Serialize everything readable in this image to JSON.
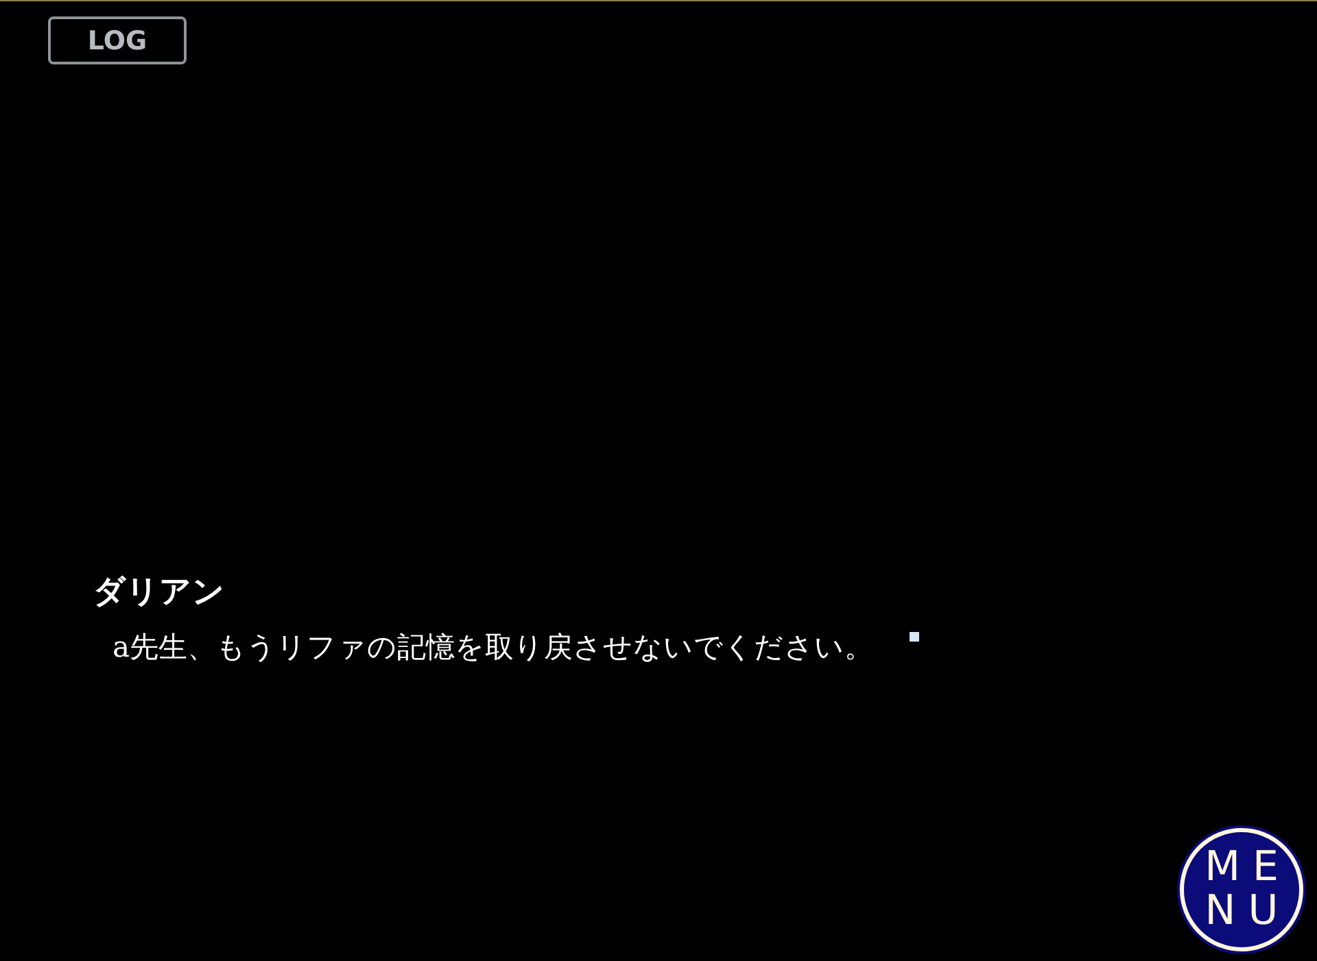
{
  "log_button": {
    "label": "LOG"
  },
  "dialogue": {
    "speaker": "ダリアン",
    "text": "a先生、もうリファの記憶を取り戻させないでください。"
  },
  "menu_button": {
    "label": "MENU"
  }
}
